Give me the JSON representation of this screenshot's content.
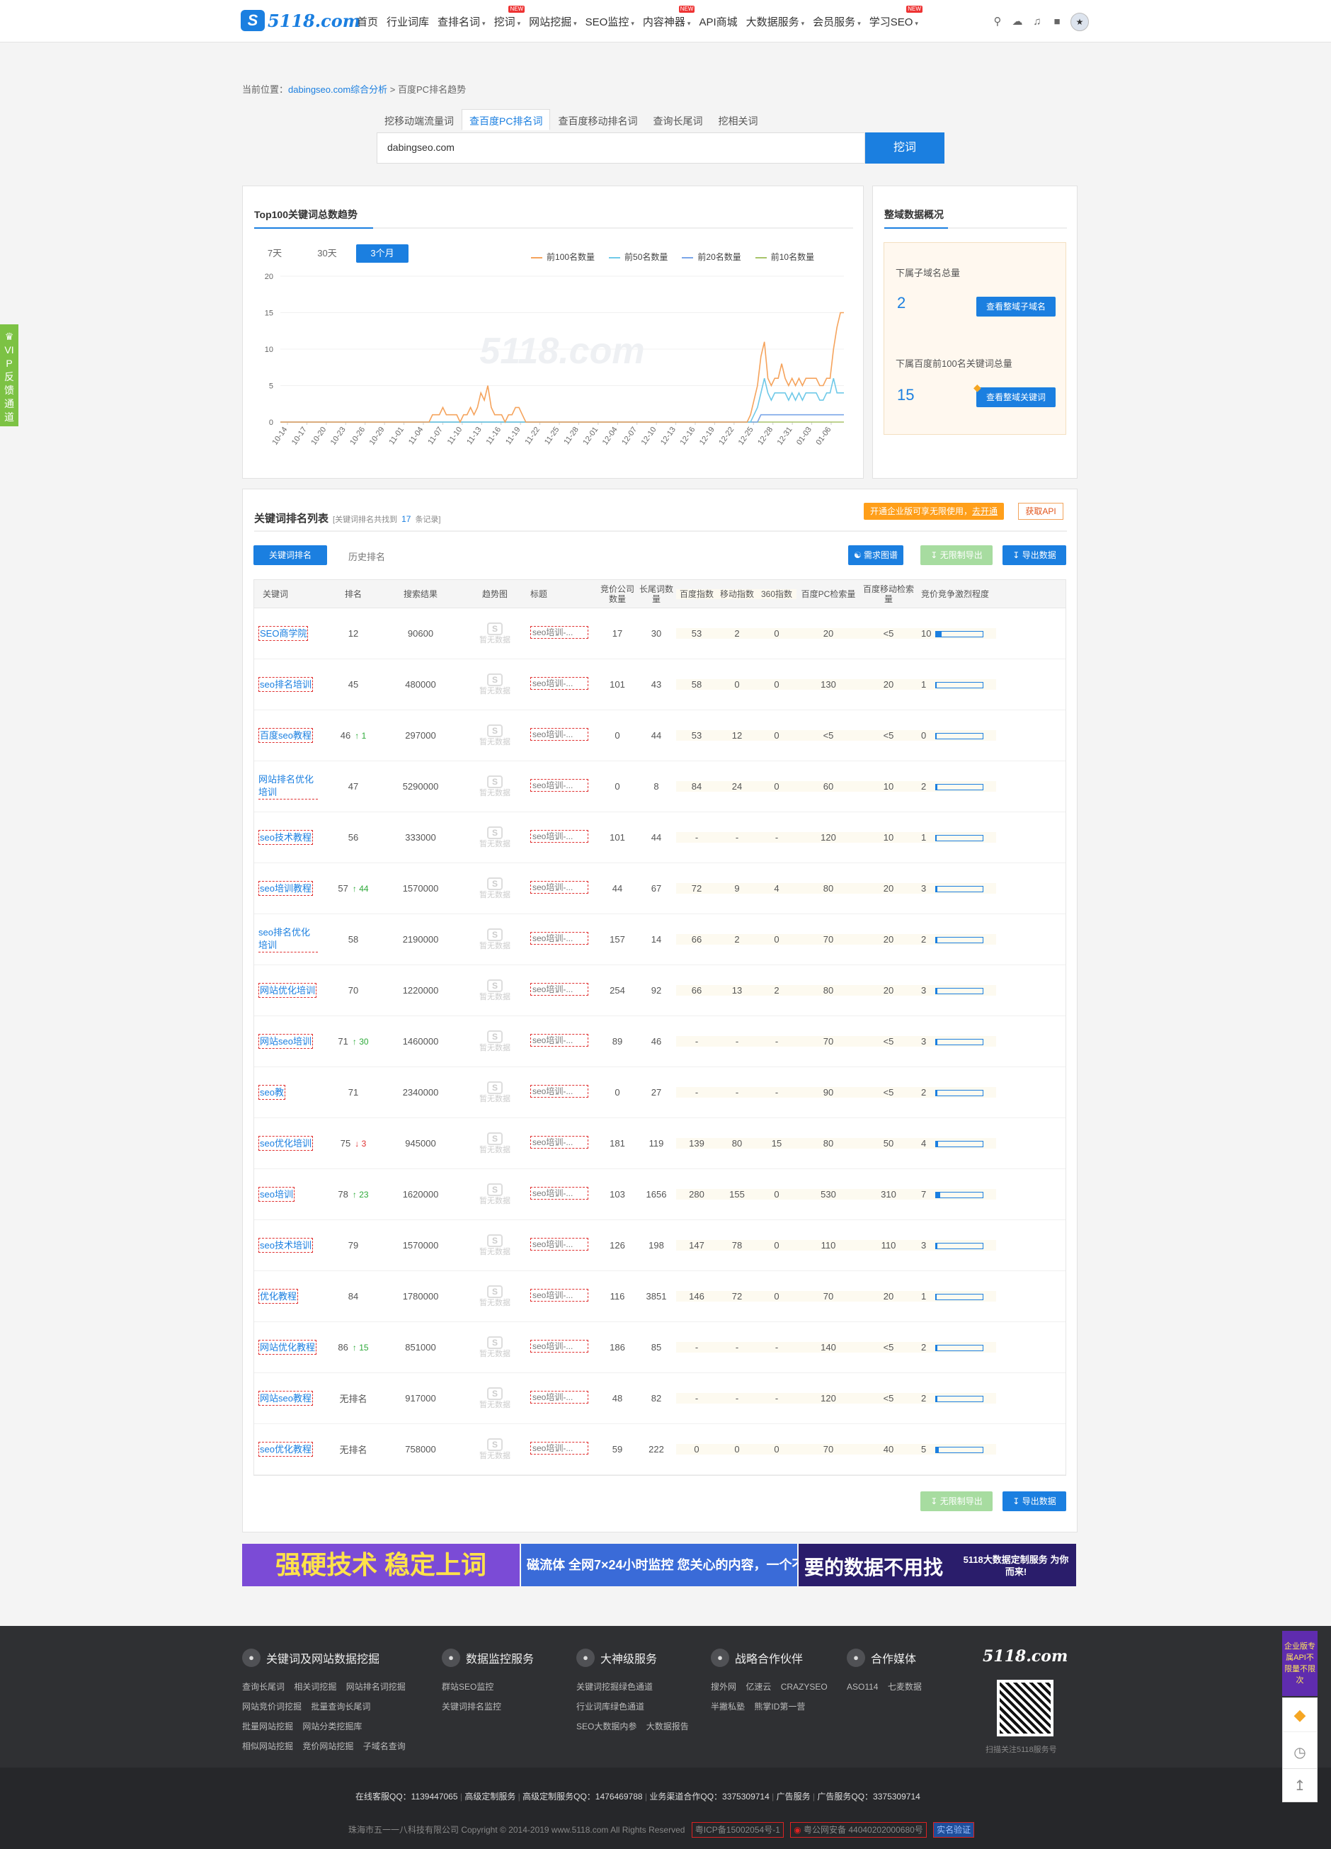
{
  "nav": {
    "logo": "5118.com",
    "items": [
      {
        "label": "首页",
        "caret": false,
        "tag": ""
      },
      {
        "label": "行业词库",
        "caret": false,
        "tag": ""
      },
      {
        "label": "查排名词",
        "caret": true,
        "tag": ""
      },
      {
        "label": "挖词",
        "caret": true,
        "tag": "NEW"
      },
      {
        "label": "网站挖掘",
        "caret": true,
        "tag": ""
      },
      {
        "label": "SEO监控",
        "caret": true,
        "tag": ""
      },
      {
        "label": "内容神器",
        "caret": true,
        "tag": "NEW"
      },
      {
        "label": "API商城",
        "caret": false,
        "tag": ""
      },
      {
        "label": "大数据服务",
        "caret": true,
        "tag": ""
      },
      {
        "label": "会员服务",
        "caret": true,
        "tag": ""
      },
      {
        "label": "学习SEO",
        "caret": true,
        "tag": "NEW"
      }
    ],
    "icons": [
      "search-icon",
      "upload-icon",
      "bell-icon",
      "lock-icon"
    ]
  },
  "vip_side": "VIP反馈通道",
  "breadcrumb": {
    "prefix": "当前位置：",
    "link": "dabingseo.com综合分析",
    "sep": " > ",
    "current": "百度PC排名趋势"
  },
  "tabs": [
    "挖移动端流量词",
    "查百度PC排名词",
    "查百度移动排名词",
    "查询长尾词",
    "挖相关词"
  ],
  "active_tab": 1,
  "search": {
    "value": "dabingseo.com",
    "button": "挖词"
  },
  "trend": {
    "title": "Top100关键词总数趋势",
    "periods": [
      "7天",
      "30天",
      "3个月"
    ],
    "active_period": 2,
    "watermark": "5118.com"
  },
  "chart_data": {
    "type": "line",
    "title": "Top100关键词总数趋势",
    "ylim": [
      0,
      20
    ],
    "yticks": [
      0,
      5,
      10,
      15,
      20
    ],
    "x_labels": [
      "10-14",
      "10-17",
      "10-20",
      "10-23",
      "10-26",
      "10-29",
      "11-01",
      "11-04",
      "11-07",
      "11-10",
      "11-13",
      "11-16",
      "11-19",
      "11-22",
      "11-25",
      "11-28",
      "12-01",
      "12-04",
      "12-07",
      "12-10",
      "12-13",
      "12-16",
      "12-19",
      "12-22",
      "12-25",
      "12-28",
      "12-31",
      "01-03",
      "01-06"
    ],
    "legend": "top-right",
    "series": [
      {
        "name": "前100名数量",
        "color": "#f5a35c",
        "values": [
          0,
          0,
          0,
          0,
          0,
          0,
          0,
          0,
          0,
          0,
          0,
          0,
          0,
          0,
          0,
          0,
          0,
          0,
          0,
          0,
          0,
          0,
          0,
          0,
          0,
          0,
          0,
          0,
          0,
          0,
          0,
          0,
          0,
          0,
          0,
          0,
          0,
          0,
          0,
          0,
          0,
          0,
          0,
          0,
          1,
          1,
          1,
          2,
          1,
          1,
          1,
          1,
          0,
          1,
          1,
          2,
          1,
          2,
          4,
          3,
          5,
          2,
          1,
          1,
          1,
          0,
          1,
          1,
          2,
          2,
          1,
          0,
          0,
          0,
          0,
          0,
          0,
          0,
          0,
          0,
          0,
          0,
          0,
          0,
          0,
          0,
          0,
          0,
          0,
          0,
          0,
          0,
          0,
          0,
          0,
          0,
          0,
          0,
          0,
          0,
          0,
          0,
          0,
          0,
          0,
          0,
          0,
          0,
          0,
          0,
          0,
          0,
          0,
          0,
          0,
          0,
          0,
          0,
          0,
          0,
          0,
          0,
          0,
          0,
          0,
          0,
          0,
          0,
          0,
          0,
          0,
          0,
          0,
          0,
          0,
          0,
          1,
          3,
          5,
          9,
          11,
          6,
          5,
          6,
          6,
          8,
          6,
          5,
          6,
          5,
          6,
          5,
          6,
          6,
          6,
          6,
          5,
          5,
          6,
          6,
          10,
          13,
          15,
          15
        ]
      },
      {
        "name": "前50名数量",
        "color": "#6fc9e8",
        "values": [
          0,
          0,
          0,
          0,
          0,
          0,
          0,
          0,
          0,
          0,
          0,
          0,
          0,
          0,
          0,
          0,
          0,
          0,
          0,
          0,
          0,
          0,
          0,
          0,
          0,
          0,
          0,
          0,
          0,
          0,
          0,
          0,
          0,
          0,
          0,
          0,
          0,
          0,
          0,
          0,
          0,
          0,
          0,
          0,
          0,
          0,
          0,
          0,
          0,
          0,
          0,
          0,
          0,
          0,
          0,
          0,
          0,
          0,
          0,
          0,
          0,
          0,
          0,
          0,
          0,
          0,
          0,
          0,
          0,
          0,
          0,
          0,
          0,
          0,
          0,
          0,
          0,
          0,
          0,
          0,
          0,
          0,
          0,
          0,
          0,
          0,
          0,
          0,
          0,
          0,
          0,
          0,
          0,
          0,
          0,
          0,
          0,
          0,
          0,
          0,
          0,
          0,
          0,
          0,
          0,
          0,
          0,
          0,
          0,
          0,
          0,
          0,
          0,
          0,
          0,
          0,
          0,
          0,
          0,
          0,
          0,
          0,
          0,
          0,
          0,
          0,
          0,
          0,
          0,
          0,
          0,
          0,
          0,
          0,
          0,
          0,
          0,
          1,
          2,
          4,
          6,
          4,
          3,
          4,
          4,
          4,
          4,
          3,
          4,
          3,
          4,
          3,
          4,
          4,
          4,
          4,
          3,
          3,
          4,
          4,
          6,
          4,
          4,
          4
        ]
      },
      {
        "name": "前20名数量",
        "color": "#7aa5e8",
        "values": [
          0,
          0,
          0,
          0,
          0,
          0,
          0,
          0,
          0,
          0,
          0,
          0,
          0,
          0,
          0,
          0,
          0,
          0,
          0,
          0,
          0,
          0,
          0,
          0,
          0,
          0,
          0,
          0,
          0,
          0,
          0,
          0,
          0,
          0,
          0,
          0,
          0,
          0,
          0,
          0,
          0,
          0,
          0,
          0,
          0,
          0,
          0,
          0,
          0,
          0,
          0,
          0,
          0,
          0,
          0,
          0,
          0,
          0,
          0,
          0,
          0,
          0,
          0,
          0,
          0,
          0,
          0,
          0,
          0,
          0,
          0,
          0,
          0,
          0,
          0,
          0,
          0,
          0,
          0,
          0,
          0,
          0,
          0,
          0,
          0,
          0,
          0,
          0,
          0,
          0,
          0,
          0,
          0,
          0,
          0,
          0,
          0,
          0,
          0,
          0,
          0,
          0,
          0,
          0,
          0,
          0,
          0,
          0,
          0,
          0,
          0,
          0,
          0,
          0,
          0,
          0,
          0,
          0,
          0,
          0,
          0,
          0,
          0,
          0,
          0,
          0,
          0,
          0,
          0,
          0,
          0,
          0,
          0,
          0,
          0,
          0,
          0,
          0,
          0,
          1,
          1,
          1,
          1,
          1,
          1,
          1,
          1,
          1,
          1,
          1,
          1,
          1,
          1,
          1,
          1,
          1,
          1,
          1,
          1,
          1,
          1,
          1,
          1,
          1
        ]
      },
      {
        "name": "前10名数量",
        "color": "#a8c46a",
        "values": [
          0,
          0,
          0,
          0,
          0,
          0,
          0,
          0,
          0,
          0,
          0,
          0,
          0,
          0,
          0,
          0,
          0,
          0,
          0,
          0,
          0,
          0,
          0,
          0,
          0,
          0,
          0,
          0,
          0,
          0,
          0,
          0,
          0,
          0,
          0,
          0,
          0,
          0,
          0,
          0,
          0,
          0,
          0,
          0,
          0,
          0,
          0,
          0,
          0,
          0,
          0,
          0,
          0,
          0,
          0,
          0,
          0,
          0,
          0,
          0,
          0,
          0,
          0,
          0,
          0,
          0,
          0,
          0,
          0,
          0,
          0,
          0,
          0,
          0,
          0,
          0,
          0,
          0,
          0,
          0,
          0,
          0,
          0,
          0,
          0,
          0,
          0,
          0,
          0,
          0,
          0,
          0,
          0,
          0,
          0,
          0,
          0,
          0,
          0,
          0,
          0,
          0,
          0,
          0,
          0,
          0,
          0,
          0,
          0,
          0,
          0,
          0,
          0,
          0,
          0,
          0,
          0,
          0,
          0,
          0,
          0,
          0,
          0,
          0,
          0,
          0,
          0,
          0,
          0,
          0,
          0,
          0,
          0,
          0,
          0,
          0,
          0,
          0,
          0,
          0,
          0,
          0,
          0,
          0,
          0,
          0,
          0,
          0,
          0,
          0,
          0,
          0,
          0,
          0,
          0,
          0,
          0,
          0,
          0,
          0,
          0,
          0,
          0,
          0
        ]
      }
    ]
  },
  "overview": {
    "title": "整域数据概况",
    "sub_label": "下属子域名总量",
    "sub_value": "2",
    "sub_btn": "查看整域子域名",
    "kw_label": "下属百度前100名关键词总量",
    "kw_value": "15",
    "kw_btn": "查看整域关键词"
  },
  "list": {
    "title": "关键词排名列表",
    "count_prefix": "[关键词排名共找到",
    "count": "17",
    "count_suffix": "条记录]",
    "promo_text": "开通企业版可享无限使用，",
    "promo_link": "去开通",
    "api_btn": "获取API",
    "subtab_active": "关键词排名",
    "subtab_other": "历史排名",
    "btn_chart": "需求图谱",
    "btn_unlimited": "无限制导出",
    "btn_export": "导出数据",
    "headers": [
      "关键词",
      "排名",
      "搜索结果",
      "趋势图",
      "标题",
      "竞价公司数量",
      "长尾词数量",
      "百度指数",
      "移动指数",
      "360指数",
      "百度PC检索量",
      "百度移动检索量",
      "竞价竞争激烈程度"
    ],
    "nodata": "暂无数据",
    "title_text": "seo培训-...",
    "rows": [
      {
        "kw": "SEO商学院",
        "rank": "12",
        "chg": "",
        "dir": "",
        "res": "90600",
        "c1": "17",
        "c2": "30",
        "c3": "53",
        "c4": "2",
        "c5": "0",
        "c6": "20",
        "c7": "<5",
        "comp": 10
      },
      {
        "kw": "seo排名培训",
        "rank": "45",
        "chg": "",
        "dir": "",
        "res": "480000",
        "c1": "101",
        "c2": "43",
        "c3": "58",
        "c4": "0",
        "c5": "0",
        "c6": "130",
        "c7": "20",
        "comp": 1
      },
      {
        "kw": "百度seo教程",
        "rank": "46",
        "chg": "1",
        "dir": "up",
        "res": "297000",
        "c1": "0",
        "c2": "44",
        "c3": "53",
        "c4": "12",
        "c5": "0",
        "c6": "<5",
        "c7": "<5",
        "comp": 0
      },
      {
        "kw": "网站排名优化培训",
        "rank": "47",
        "chg": "",
        "dir": "",
        "res": "5290000",
        "c1": "0",
        "c2": "8",
        "c3": "84",
        "c4": "24",
        "c5": "0",
        "c6": "60",
        "c7": "10",
        "comp": 2
      },
      {
        "kw": "seo技术教程",
        "rank": "56",
        "chg": "",
        "dir": "",
        "res": "333000",
        "c1": "101",
        "c2": "44",
        "c3": "-",
        "c4": "-",
        "c5": "-",
        "c6": "120",
        "c7": "10",
        "comp": 1
      },
      {
        "kw": "seo培训教程",
        "rank": "57",
        "chg": "44",
        "dir": "up",
        "res": "1570000",
        "c1": "44",
        "c2": "67",
        "c3": "72",
        "c4": "9",
        "c5": "4",
        "c6": "80",
        "c7": "20",
        "comp": 3
      },
      {
        "kw": "seo排名优化培训",
        "rank": "58",
        "chg": "",
        "dir": "",
        "res": "2190000",
        "c1": "157",
        "c2": "14",
        "c3": "66",
        "c4": "2",
        "c5": "0",
        "c6": "70",
        "c7": "20",
        "comp": 2
      },
      {
        "kw": "网站优化培训",
        "rank": "70",
        "chg": "",
        "dir": "",
        "res": "1220000",
        "c1": "254",
        "c2": "92",
        "c3": "66",
        "c4": "13",
        "c5": "2",
        "c6": "80",
        "c7": "20",
        "comp": 3
      },
      {
        "kw": "网站seo培训",
        "rank": "71",
        "chg": "30",
        "dir": "up",
        "res": "1460000",
        "c1": "89",
        "c2": "46",
        "c3": "-",
        "c4": "-",
        "c5": "-",
        "c6": "70",
        "c7": "<5",
        "comp": 3
      },
      {
        "kw": "seo教",
        "rank": "71",
        "chg": "",
        "dir": "",
        "res": "2340000",
        "c1": "0",
        "c2": "27",
        "c3": "-",
        "c4": "-",
        "c5": "-",
        "c6": "90",
        "c7": "<5",
        "comp": 2
      },
      {
        "kw": "seo优化培训",
        "rank": "75",
        "chg": "3",
        "dir": "down",
        "res": "945000",
        "c1": "181",
        "c2": "119",
        "c3": "139",
        "c4": "80",
        "c5": "15",
        "c6": "80",
        "c7": "50",
        "comp": 4
      },
      {
        "kw": "seo培训",
        "rank": "78",
        "chg": "23",
        "dir": "up",
        "res": "1620000",
        "c1": "103",
        "c2": "1656",
        "c3": "280",
        "c4": "155",
        "c5": "0",
        "c6": "530",
        "c7": "310",
        "comp": 7
      },
      {
        "kw": "seo技术培训",
        "rank": "79",
        "chg": "",
        "dir": "",
        "res": "1570000",
        "c1": "126",
        "c2": "198",
        "c3": "147",
        "c4": "78",
        "c5": "0",
        "c6": "110",
        "c7": "110",
        "comp": 3
      },
      {
        "kw": "优化教程",
        "rank": "84",
        "chg": "",
        "dir": "",
        "res": "1780000",
        "c1": "116",
        "c2": "3851",
        "c3": "146",
        "c4": "72",
        "c5": "0",
        "c6": "70",
        "c7": "20",
        "comp": 1
      },
      {
        "kw": "网站优化教程",
        "rank": "86",
        "chg": "15",
        "dir": "up",
        "res": "851000",
        "c1": "186",
        "c2": "85",
        "c3": "-",
        "c4": "-",
        "c5": "-",
        "c6": "140",
        "c7": "<5",
        "comp": 2
      },
      {
        "kw": "网站seo教程",
        "rank": "无排名",
        "chg": "",
        "dir": "",
        "res": "917000",
        "c1": "48",
        "c2": "82",
        "c3": "-",
        "c4": "-",
        "c5": "-",
        "c6": "120",
        "c7": "<5",
        "comp": 2
      },
      {
        "kw": "seo优化教程",
        "rank": "无排名",
        "chg": "",
        "dir": "",
        "res": "758000",
        "c1": "59",
        "c2": "222",
        "c3": "0",
        "c4": "0",
        "c5": "0",
        "c6": "70",
        "c7": "40",
        "comp": 5
      }
    ]
  },
  "banners": [
    {
      "text": "强硬技术 稳定上词",
      "bg": "#7b4bd6",
      "color": "#ffe24a"
    },
    {
      "text": "磁流体 全网7×24小时监控 您关心的内容，一个不漏",
      "bg": "#3a6bd8",
      "color": "#ffffff"
    },
    {
      "text": "要的数据不用找",
      "sub": "5118大数据定制服务 为你而来!",
      "bg": "#2a1d6b",
      "color": "#ffffff"
    }
  ],
  "footer": {
    "cols": [
      {
        "title": "关键词及网站数据挖掘",
        "icon": "search-icon",
        "links": [
          "查询长尾词",
          "相关词挖掘",
          "网站排名词挖掘",
          "网站竞价词挖掘",
          "批量查询长尾词",
          "批量网站挖掘",
          "网站分类挖掘库",
          "相似网站挖掘",
          "竞价网站挖掘",
          "子域名查询"
        ]
      },
      {
        "title": "数据监控服务",
        "icon": "monitor-icon",
        "links": [
          "群站SEO监控",
          "关键词排名监控"
        ]
      },
      {
        "title": "大神级服务",
        "icon": "diamond-icon",
        "links": [
          "关键词挖掘绿色通道",
          "行业词库绿色通道",
          "SEO大数据内参",
          "大数据报告"
        ]
      },
      {
        "title": "战略合作伙伴",
        "icon": "handshake-icon",
        "links": [
          "搜外网",
          "亿速云",
          "CRAZYSEO",
          "半撇私塾",
          "熊掌ID第一营"
        ]
      },
      {
        "title": "合作媒体",
        "icon": "user-icon",
        "links": [
          "ASO114",
          "七麦数据"
        ]
      }
    ],
    "logo": "5118.com",
    "qr_label": "扫描关注5118服务号",
    "contacts": [
      "在线客服QQ：1139447065",
      "高级定制服务",
      "高级定制服务QQ：1476469788",
      "业务渠道合作QQ：3375309714",
      "广告服务",
      "广告服务QQ：3375309714"
    ],
    "copyright": "珠海市五一一八科技有限公司 Copyright © 2014-2019 www.5118.com All Rights Reserved",
    "icp": "粤ICP备15002054号-1",
    "police": "粤公网安备 44040202000680号",
    "badge": "实名验证"
  },
  "side": {
    "badge": "企业版专属API不限量不限次",
    "icons": [
      "vip-icon",
      "history-icon",
      "top-icon"
    ]
  }
}
